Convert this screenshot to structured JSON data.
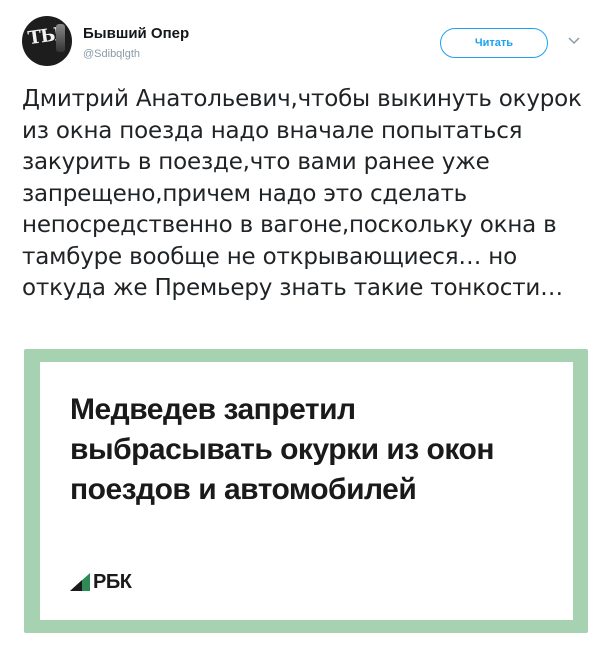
{
  "tweet": {
    "author": {
      "name": "Бывший Опер",
      "handle": "@Sdibqlgth"
    },
    "follow_label": "Читать",
    "text": "Дмитрий Анатольевич,чтобы выкинуть окурок из окна поезда надо вначале попытаться закурить в поезде,что вами ранее уже запрещено,причем надо это сделать непосредственно в вагоне,поскольку окна в тамбуре вообще не открывающиеся… но откуда же Премьеру знать такие тонкости…"
  },
  "card": {
    "headline": "Медведев запретил выбрасывать окурки из окон поездов и автомобилей",
    "logo_text": "РБК",
    "border_color": "#a7d2b2",
    "logo_accent": "#2e8b57"
  },
  "colors": {
    "accent": "#1da1f2",
    "muted": "#8a9aa8"
  },
  "icons": {
    "menu": "chevron-down-icon",
    "logo": "rbc-logo-icon"
  }
}
